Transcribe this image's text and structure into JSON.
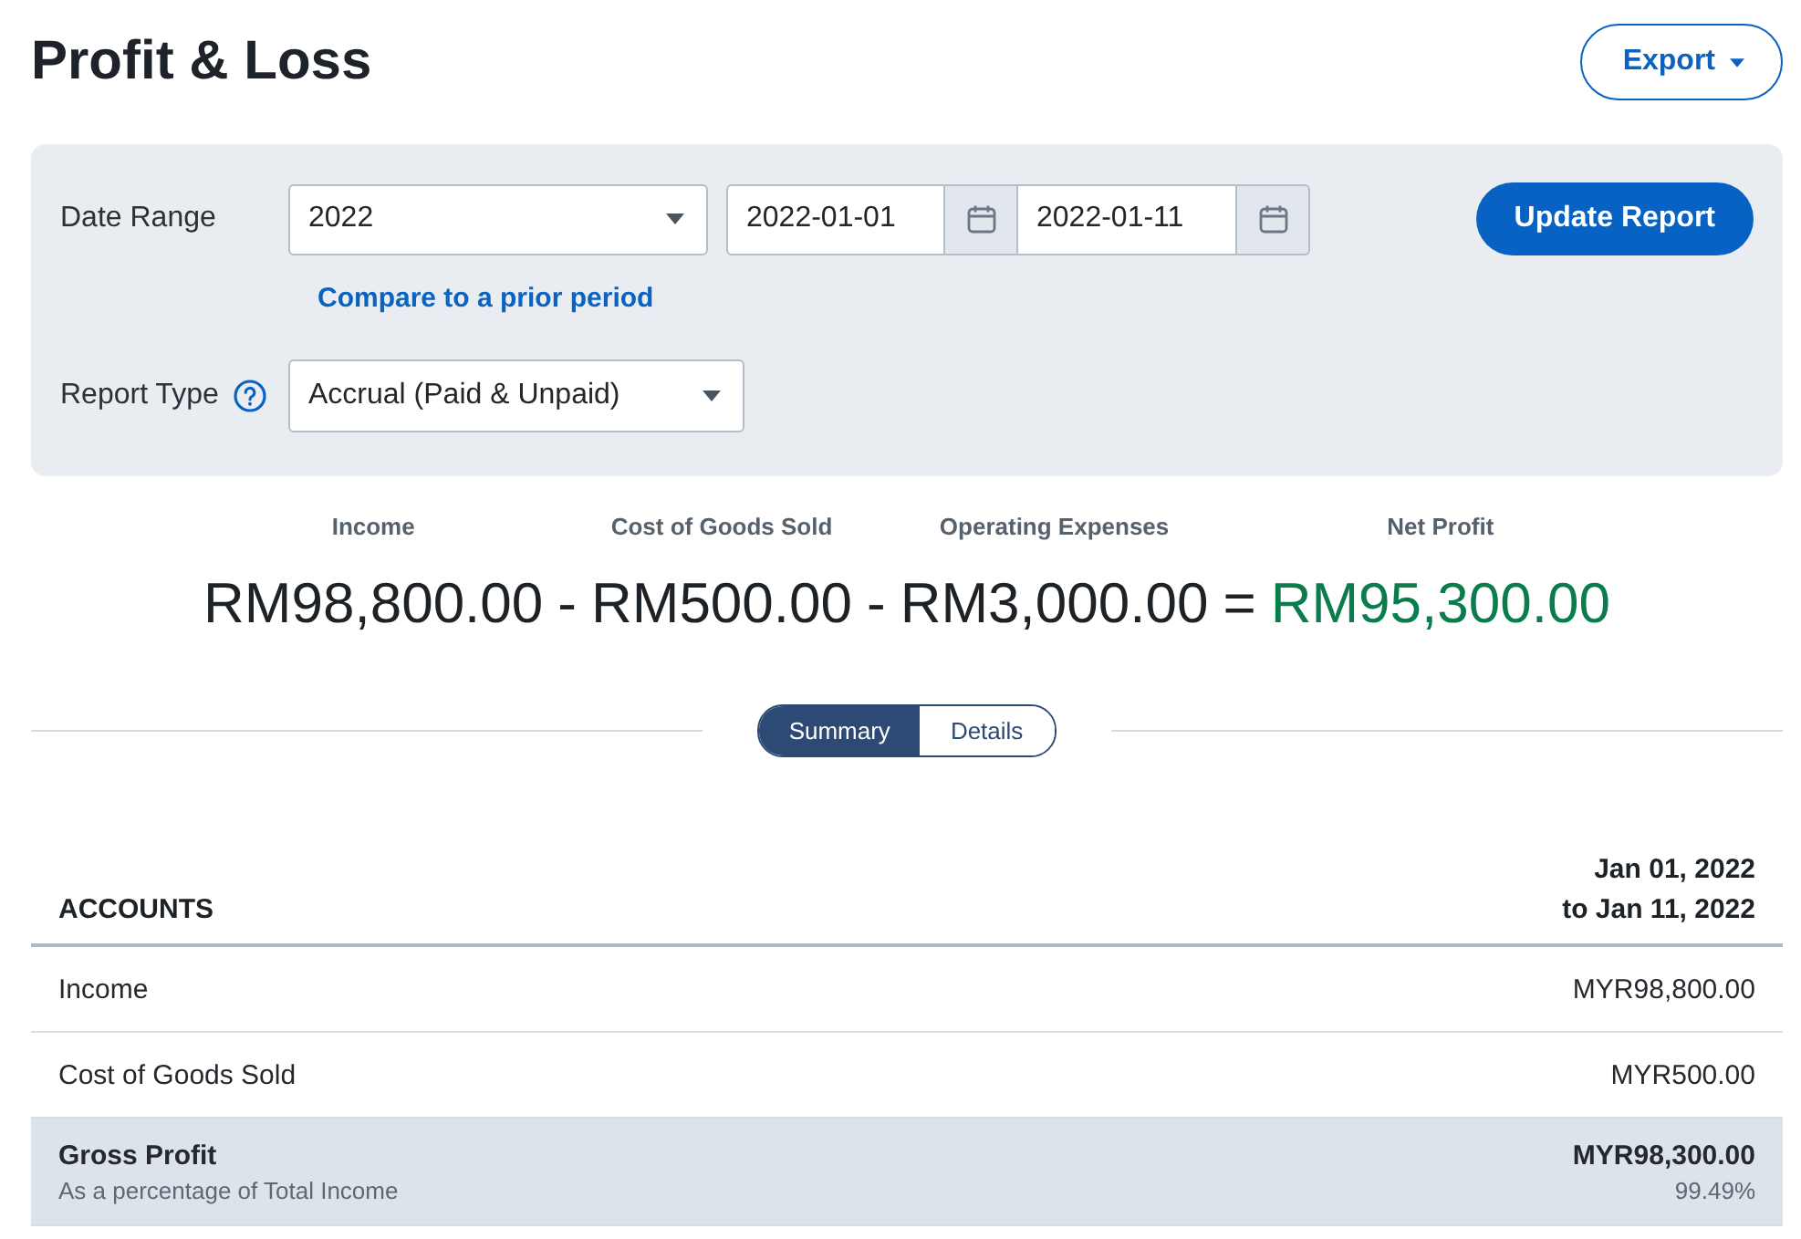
{
  "header": {
    "title": "Profit & Loss",
    "export_button": "Export"
  },
  "filters": {
    "date_range": {
      "label": "Date Range",
      "preset": "2022",
      "start_date": "2022-01-01",
      "end_date": "2022-01-11",
      "compare_link": "Compare to a prior period"
    },
    "report_type": {
      "label": "Report Type",
      "value": "Accrual (Paid & Unpaid)"
    },
    "update_button": "Update Report"
  },
  "summary": [
    {
      "label": "Income",
      "amount": "RM98,800.00",
      "operator": "-",
      "kind": "term"
    },
    {
      "label": "Cost of Goods Sold",
      "amount": "RM500.00",
      "operator": "-",
      "kind": "term"
    },
    {
      "label": "Operating Expenses",
      "amount": "RM3,000.00",
      "operator": "=",
      "kind": "term"
    },
    {
      "label": "Net Profit",
      "amount": "RM95,300.00",
      "kind": "result"
    }
  ],
  "view_tabs": [
    {
      "label": "Summary",
      "selected": true
    },
    {
      "label": "Details",
      "selected": false
    }
  ],
  "table": {
    "columns": [
      {
        "lines": [
          "ACCOUNTS"
        ]
      },
      {
        "lines": [
          "Jan 01, 2022",
          "to Jan 11, 2022"
        ]
      }
    ],
    "rows": [
      {
        "kind": "line",
        "account": "Income",
        "amount": "MYR98,800.00"
      },
      {
        "kind": "line",
        "account": "Cost of Goods Sold",
        "amount": "MYR500.00"
      },
      {
        "kind": "total",
        "account": "Gross Profit",
        "amount": "MYR98,300.00",
        "note": "As a percentage of Total Income",
        "percent": "99.49%"
      }
    ]
  }
}
